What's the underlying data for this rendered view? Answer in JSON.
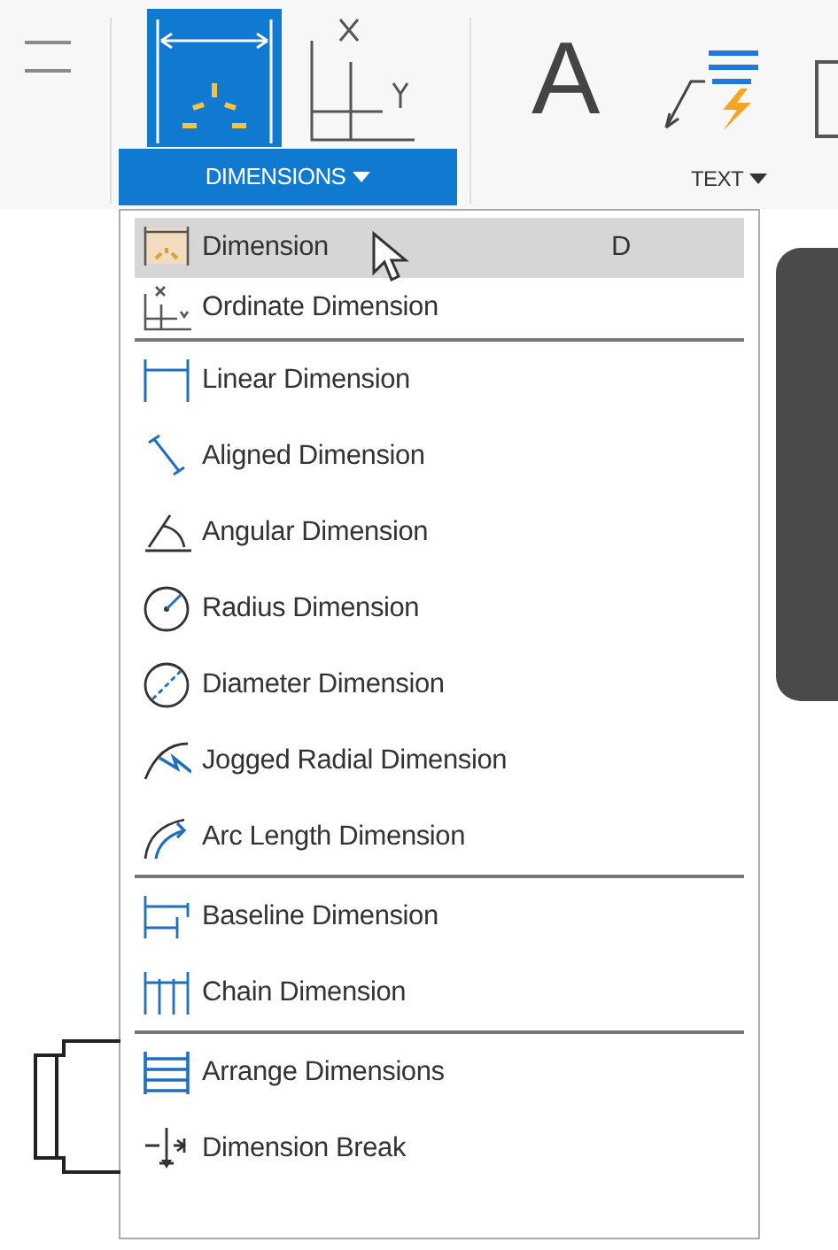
{
  "toolbar": {
    "groups": [
      {
        "label": "DIMENSIONS",
        "selected": true
      },
      {
        "label": "TEXT",
        "selected": false
      }
    ],
    "letter_icon": "A"
  },
  "menu": {
    "sections": [
      [
        {
          "label": "Dimension",
          "shortcut": "D",
          "kind": "dimension",
          "selected": true
        },
        {
          "label": "Ordinate Dimension",
          "kind": "ordinate",
          "selected": false
        }
      ],
      [
        {
          "label": "Linear Dimension",
          "kind": "linear",
          "selected": false
        },
        {
          "label": "Aligned Dimension",
          "kind": "aligned",
          "selected": false
        },
        {
          "label": "Angular Dimension",
          "kind": "angular",
          "selected": false
        },
        {
          "label": "Radius Dimension",
          "kind": "radius",
          "selected": false
        },
        {
          "label": "Diameter Dimension",
          "kind": "diameter",
          "selected": false
        },
        {
          "label": "Jogged Radial Dimension",
          "kind": "jogged",
          "selected": false
        },
        {
          "label": "Arc Length Dimension",
          "kind": "arc",
          "selected": false
        }
      ],
      [
        {
          "label": "Baseline Dimension",
          "kind": "baseline",
          "selected": false
        },
        {
          "label": "Chain Dimension",
          "kind": "chain",
          "selected": false
        }
      ],
      [
        {
          "label": "Arrange Dimensions",
          "kind": "arrange",
          "selected": false
        },
        {
          "label": "Dimension Break",
          "kind": "break",
          "selected": false
        }
      ]
    ]
  }
}
